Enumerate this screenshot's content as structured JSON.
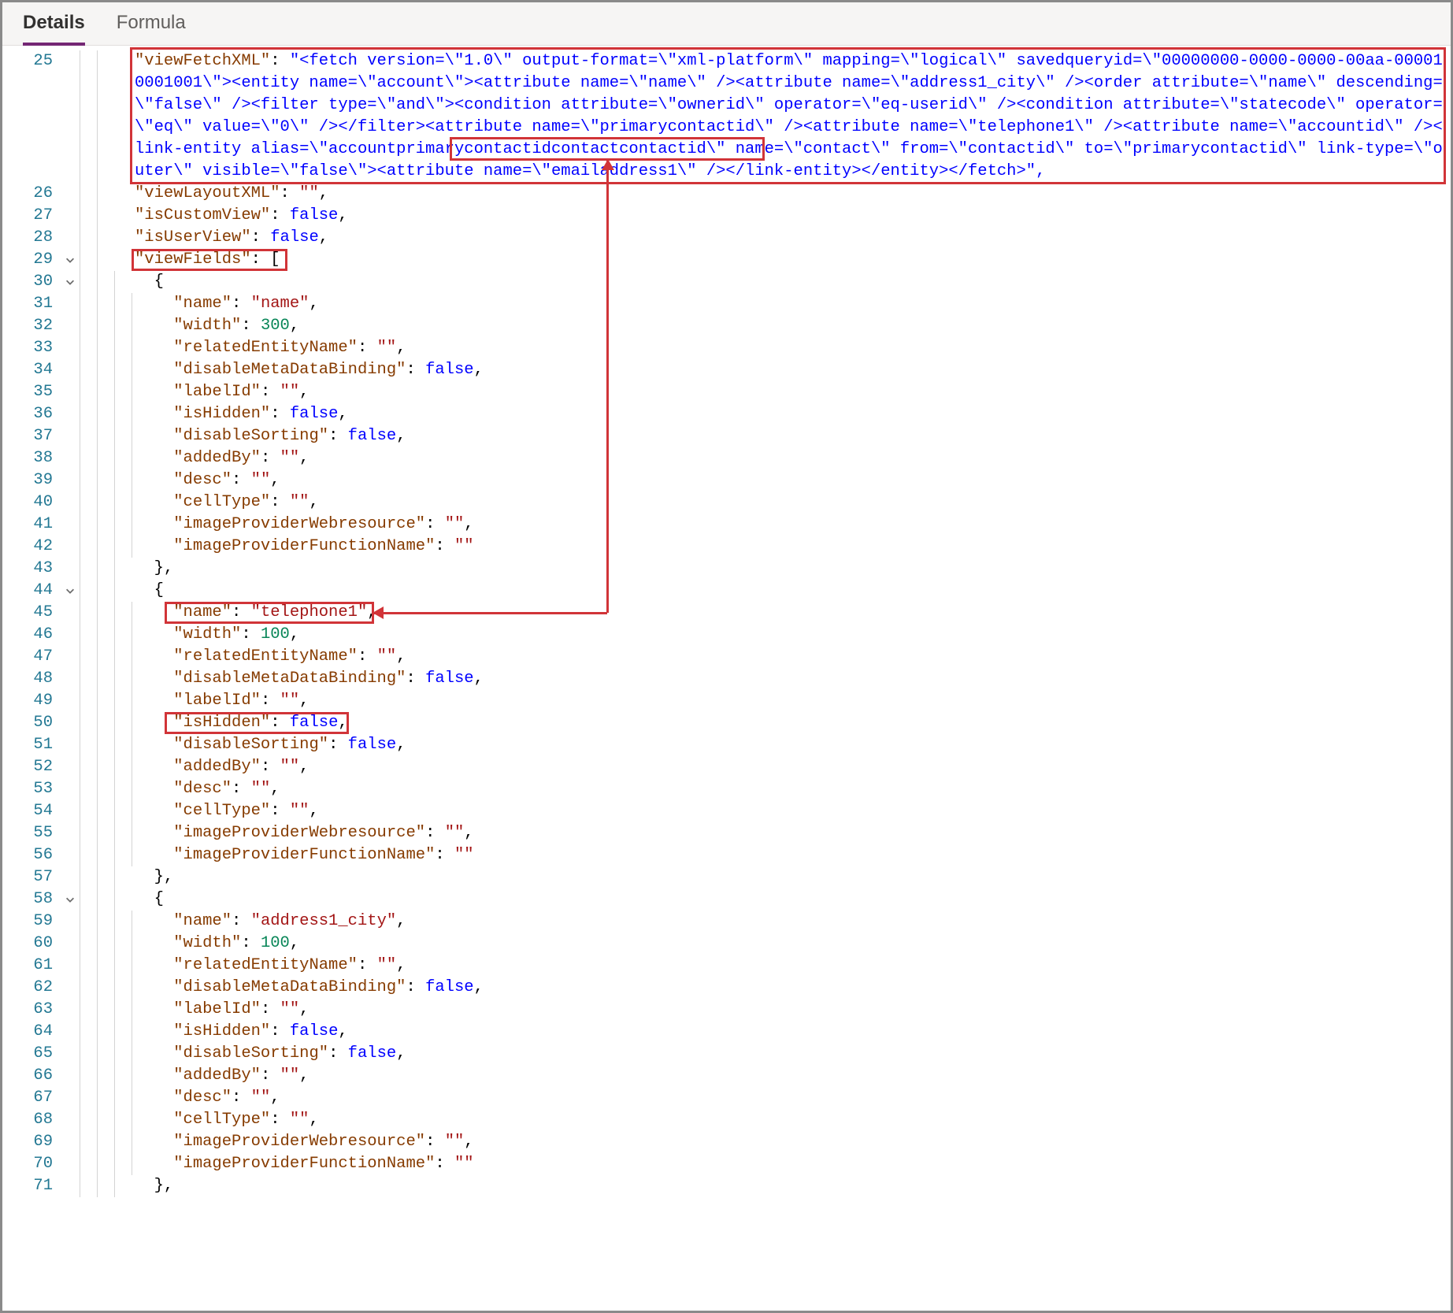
{
  "tabs": {
    "details": "Details",
    "formula": "Formula"
  },
  "line_numbers": [
    "25",
    "26",
    "27",
    "28",
    "29",
    "30",
    "31",
    "32",
    "33",
    "34",
    "35",
    "36",
    "37",
    "38",
    "39",
    "40",
    "41",
    "42",
    "43",
    "44",
    "45",
    "46",
    "47",
    "48",
    "49",
    "50",
    "51",
    "52",
    "53",
    "54",
    "55",
    "56",
    "57",
    "58",
    "59",
    "60",
    "61",
    "62",
    "63",
    "64",
    "65",
    "66",
    "67",
    "68",
    "69",
    "70",
    "71"
  ],
  "fold_rows": {
    "29": true,
    "30": true,
    "44": true,
    "58": true
  },
  "code": {
    "l25": {
      "key": "\"viewFetchXML\"",
      "val": "\"<fetch version=\\\"1.0\\\" output-format=\\\"xml-platform\\\" mapping=\\\"logical\\\" savedqueryid=\\\"00000000-0000-0000-00aa-000010001001\\\"><entity name=\\\"account\\\"><attribute name=\\\"name\\\" /><attribute name=\\\"address1_city\\\" /><order attribute=\\\"name\\\" descending=\\\"false\\\" /><filter type=\\\"and\\\"><condition attribute=\\\"ownerid\\\" operator=\\\"eq-userid\\\" /><condition attribute=\\\"statecode\\\" operator=\\\"eq\\\" value=\\\"0\\\" /></filter><attribute name=\\\"primarycontactid\\\" /><attribute name=\\\"telephone1\\\" /><attribute name=\\\"accountid\\\" /><link-entity alias=\\\"accountprimarycontactidcontactcontactid\\\" name=\\\"contact\\\" from=\\\"contactid\\\" to=\\\"primarycontactid\\\" link-type=\\\"outer\\\" visible=\\\"false\\\"><attribute name=\\\"emailaddress1\\\" /></link-entity></entity></fetch>\","
    },
    "l26": {
      "key": "\"viewLayoutXML\"",
      "val": "\"\""
    },
    "l27": {
      "key": "\"isCustomView\"",
      "val": "false"
    },
    "l28": {
      "key": "\"isUserView\"",
      "val": "false"
    },
    "l29": {
      "key": "\"viewFields\"",
      "val": "["
    },
    "l30": "{",
    "l31": {
      "key": "\"name\"",
      "val": "\"name\""
    },
    "l32": {
      "key": "\"width\"",
      "val": "300"
    },
    "l33": {
      "key": "\"relatedEntityName\"",
      "val": "\"\""
    },
    "l34": {
      "key": "\"disableMetaDataBinding\"",
      "val": "false"
    },
    "l35": {
      "key": "\"labelId\"",
      "val": "\"\""
    },
    "l36": {
      "key": "\"isHidden\"",
      "val": "false"
    },
    "l37": {
      "key": "\"disableSorting\"",
      "val": "false"
    },
    "l38": {
      "key": "\"addedBy\"",
      "val": "\"\""
    },
    "l39": {
      "key": "\"desc\"",
      "val": "\"\""
    },
    "l40": {
      "key": "\"cellType\"",
      "val": "\"\""
    },
    "l41": {
      "key": "\"imageProviderWebresource\"",
      "val": "\"\""
    },
    "l42": {
      "key": "\"imageProviderFunctionName\"",
      "val": "\"\""
    },
    "l43": "},",
    "l44": "{",
    "l45": {
      "key": "\"name\"",
      "val": "\"telephone1\""
    },
    "l46": {
      "key": "\"width\"",
      "val": "100"
    },
    "l47": {
      "key": "\"relatedEntityName\"",
      "val": "\"\""
    },
    "l48": {
      "key": "\"disableMetaDataBinding\"",
      "val": "false"
    },
    "l49": {
      "key": "\"labelId\"",
      "val": "\"\""
    },
    "l50": {
      "key": "\"isHidden\"",
      "val": "false"
    },
    "l51": {
      "key": "\"disableSorting\"",
      "val": "false"
    },
    "l52": {
      "key": "\"addedBy\"",
      "val": "\"\""
    },
    "l53": {
      "key": "\"desc\"",
      "val": "\"\""
    },
    "l54": {
      "key": "\"cellType\"",
      "val": "\"\""
    },
    "l55": {
      "key": "\"imageProviderWebresource\"",
      "val": "\"\""
    },
    "l56": {
      "key": "\"imageProviderFunctionName\"",
      "val": "\"\""
    },
    "l57": "},",
    "l58": "{",
    "l59": {
      "key": "\"name\"",
      "val": "\"address1_city\""
    },
    "l60": {
      "key": "\"width\"",
      "val": "100"
    },
    "l61": {
      "key": "\"relatedEntityName\"",
      "val": "\"\""
    },
    "l62": {
      "key": "\"disableMetaDataBinding\"",
      "val": "false"
    },
    "l63": {
      "key": "\"labelId\"",
      "val": "\"\""
    },
    "l64": {
      "key": "\"isHidden\"",
      "val": "false"
    },
    "l65": {
      "key": "\"disableSorting\"",
      "val": "false"
    },
    "l66": {
      "key": "\"addedBy\"",
      "val": "\"\""
    },
    "l67": {
      "key": "\"desc\"",
      "val": "\"\""
    },
    "l68": {
      "key": "\"cellType\"",
      "val": "\"\""
    },
    "l69": {
      "key": "\"imageProviderWebresource\"",
      "val": "\"\""
    },
    "l70": {
      "key": "\"imageProviderFunctionName\"",
      "val": "\"\""
    },
    "l71": "},"
  }
}
